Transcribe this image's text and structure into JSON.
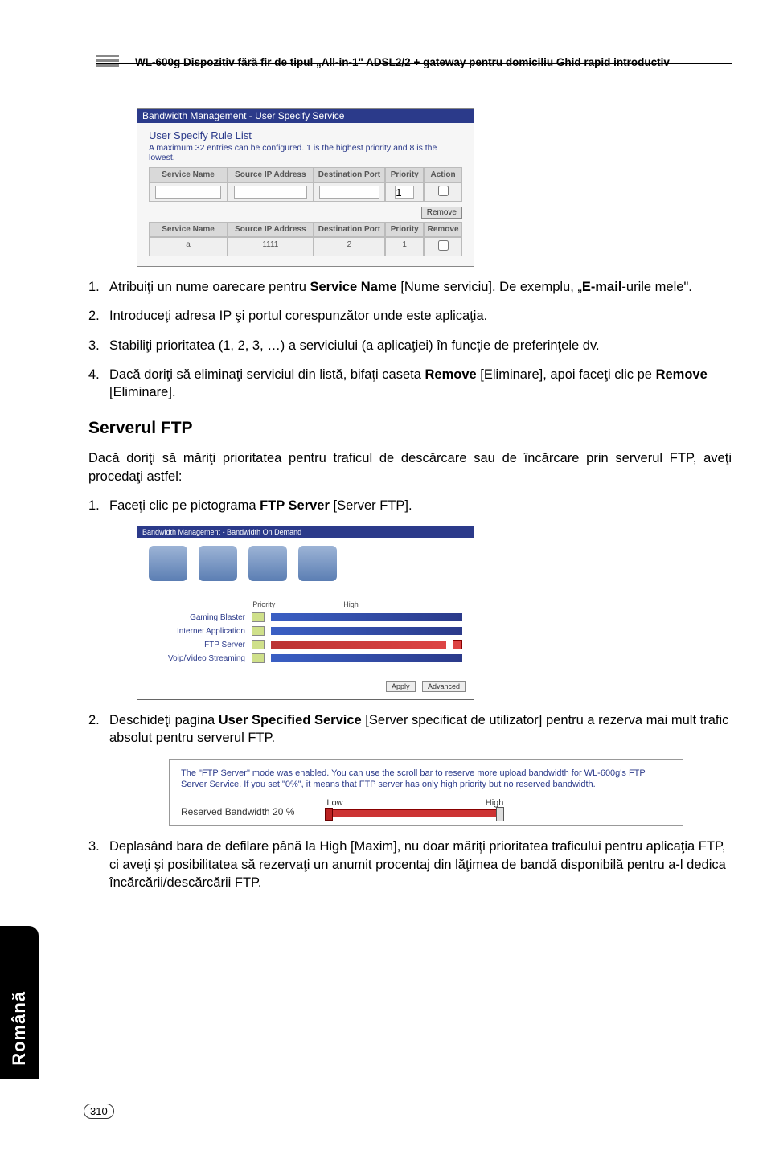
{
  "header": {
    "product_line": "WL-600g Dispozitiv fără fir de tipul „All-in-1\" ADSL2/2 + gateway pentru domiciliu Ghid rapid introductiv"
  },
  "figure1": {
    "titlebar": "Bandwidth Management - User Specify Service",
    "subheader": "User Specify Rule List",
    "note": "A maximum 32 entries can be configured. 1 is the highest priority and 8 is the lowest.",
    "headers": {
      "name": "Service Name",
      "source": "Source IP Address",
      "dest": "Destination Port",
      "priority": "Priority",
      "action": "Action"
    },
    "row2_headers": {
      "name": "Service Name",
      "source": "Source IP Address",
      "dest": "Destination Port",
      "priority": "Priority",
      "remove": "Remove"
    },
    "row2_values": {
      "name": "a",
      "source": "1111",
      "dest": "2",
      "priority": "1"
    },
    "input_priority": "1",
    "remove_btn": "Remove"
  },
  "steps1": [
    {
      "num": "1.",
      "pre": "Atribuiţi un nume oarecare pentru ",
      "bold": "Service Name",
      "post": " [Nume serviciu]. De exemplu, „",
      "bold2": "E-mail",
      "post2": "-urile mele\"."
    },
    {
      "num": "2.",
      "text": "Introduceţi adresa IP şi portul corespunzător unde este aplicaţia."
    },
    {
      "num": "3.",
      "text": "Stabiliţi prioritatea (1, 2, 3, …) a serviciului (a aplicaţiei) în funcţie de preferinţele dv."
    },
    {
      "num": "4.",
      "pre": "Dacă doriţi să eliminaţi serviciul din listă, bifaţi caseta ",
      "bold": "Remove",
      "mid": " [Eliminare], apoi faceţi clic pe ",
      "bold2": "Remove",
      "post": " [Eliminare]."
    }
  ],
  "section_ftp": "Serverul FTP",
  "ftp_intro": "Dacă doriţi să măriţi prioritatea pentru traficul de descărcare sau de încărcare prin serverul FTP, aveţi procedaţi astfel:",
  "steps2_item1": {
    "num": "1.",
    "pre": "Faceţi clic pe pictograma ",
    "bold": "FTP Server",
    "post": " [Server FTP]."
  },
  "figure2": {
    "titlebar": "Bandwidth Management - Bandwidth On Demand",
    "priority_label": "Priority",
    "high_label": "High",
    "sliders": [
      {
        "label": "Gaming Blaster"
      },
      {
        "label": "Internet Application"
      },
      {
        "label": "FTP Server"
      },
      {
        "label": "Voip/Video Streaming"
      }
    ],
    "btn_apply": "Apply",
    "btn_advanced": "Advanced"
  },
  "steps2_item2": {
    "num": "2.",
    "pre": "Deschideţi pagina ",
    "bold": "User Specified Service",
    "post": " [Server specificat de utilizator] pentru a rezerva mai mult trafic absolut pentru serverul FTP."
  },
  "figure3": {
    "note": "The \"FTP Server\" mode was enabled. You can use the scroll bar to reserve more upload bandwidth for WL-600g's FTP Server Service. If you set \"0%\", it means that FTP server has only high priority but no reserved bandwidth.",
    "low": "Low",
    "high": "High",
    "label": "Reserved Bandwidth 20   %"
  },
  "steps2_item3": {
    "num": "3.",
    "text": "Deplasând bara de defilare până la High [Maxim], nu doar măriţi prioritatea traficului pentru aplicaţia FTP, ci aveţi şi posibilitatea să rezervaţi un anumit procentaj din lăţimea de bandă disponibilă pentru a-l dedica încărcării/descărcării FTP."
  },
  "sidebar": "Română",
  "page_number": "310"
}
